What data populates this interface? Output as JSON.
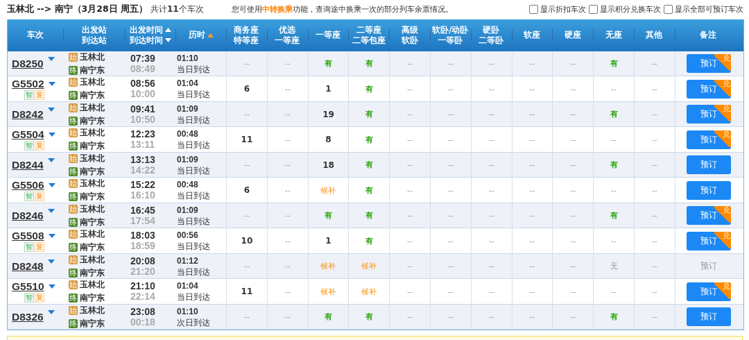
{
  "route": {
    "title": "玉林北 --> 南宁（3月28日  周五）",
    "count_prefix": "共计",
    "count": "11",
    "count_suffix": "个车次"
  },
  "notice": {
    "before": "您可使用",
    "link": "中转换乘",
    "after": "功能，查询途中换乘一次的部分列车余票情况。"
  },
  "filters": [
    {
      "label": "显示折扣车次",
      "checked": false
    },
    {
      "label": "显示积分兑换车次",
      "checked": false
    },
    {
      "label": "显示全部可预订车次",
      "checked": false
    }
  ],
  "columns": [
    {
      "lines": [
        {
          "text": "车次"
        }
      ]
    },
    {
      "lines": [
        {
          "text": "出发站"
        },
        {
          "text": "到达站"
        }
      ]
    },
    {
      "lines": [
        {
          "text": "出发时间",
          "ascending": true,
          "active": false
        },
        {
          "text": "到达时间",
          "ascending": false,
          "active": false
        }
      ]
    },
    {
      "lines": [
        {
          "text": "历时",
          "ascending": true,
          "active": true
        }
      ]
    },
    {
      "lines": [
        {
          "text": "商务座"
        },
        {
          "text": "特等座"
        }
      ]
    },
    {
      "lines": [
        {
          "text": "优选"
        },
        {
          "text": "一等座"
        }
      ]
    },
    {
      "lines": [
        {
          "text": "一等座"
        }
      ]
    },
    {
      "lines": [
        {
          "text": "二等座"
        },
        {
          "text": "二等包座"
        }
      ]
    },
    {
      "lines": [
        {
          "text": "高级"
        },
        {
          "text": "软卧"
        }
      ]
    },
    {
      "lines": [
        {
          "text": "软卧/动卧"
        },
        {
          "text": "一等卧"
        }
      ]
    },
    {
      "lines": [
        {
          "text": "硬卧"
        },
        {
          "text": "二等卧"
        }
      ]
    },
    {
      "lines": [
        {
          "text": "软座"
        }
      ]
    },
    {
      "lines": [
        {
          "text": "硬座"
        }
      ]
    },
    {
      "lines": [
        {
          "text": "无座"
        }
      ]
    },
    {
      "lines": [
        {
          "text": "其他"
        }
      ]
    },
    {
      "lines": [
        {
          "text": "备注"
        }
      ]
    }
  ],
  "trains": [
    {
      "number": "D8250",
      "from_tag": "始",
      "from": "玉林北",
      "to_tag": "终",
      "to": "南宁东",
      "depart": "07:39",
      "arrive": "08:49",
      "duration": "01:10",
      "arrival_day": "当日到达",
      "seats": [
        {
          "t": "--",
          "kind": "none"
        },
        {
          "t": "--",
          "kind": "none"
        },
        {
          "t": "有",
          "kind": "have"
        },
        {
          "t": "有",
          "kind": "have"
        },
        {
          "t": "--",
          "kind": "none"
        },
        {
          "t": "--",
          "kind": "none"
        },
        {
          "t": "--",
          "kind": "none"
        },
        {
          "t": "--",
          "kind": "none"
        },
        {
          "t": "--",
          "kind": "none"
        },
        {
          "t": "有",
          "kind": "have"
        },
        {
          "t": "--",
          "kind": "none"
        }
      ],
      "book": {
        "label": "预订",
        "enabled": true,
        "badge": "兑"
      }
    },
    {
      "number": "G5502",
      "tags": [
        {
          "text": "智",
          "kind": "smart"
        },
        {
          "text": "复",
          "kind": "return"
        }
      ],
      "from_tag": "始",
      "from": "玉林北",
      "to_tag": "终",
      "to": "南宁东",
      "depart": "08:56",
      "arrive": "10:00",
      "duration": "01:04",
      "arrival_day": "当日到达",
      "seats": [
        {
          "t": "6",
          "kind": "count"
        },
        {
          "t": "--",
          "kind": "none"
        },
        {
          "t": "1",
          "kind": "count"
        },
        {
          "t": "有",
          "kind": "have"
        },
        {
          "t": "--",
          "kind": "none"
        },
        {
          "t": "--",
          "kind": "none"
        },
        {
          "t": "--",
          "kind": "none"
        },
        {
          "t": "--",
          "kind": "none"
        },
        {
          "t": "--",
          "kind": "none"
        },
        {
          "t": "--",
          "kind": "none"
        },
        {
          "t": "--",
          "kind": "none"
        }
      ],
      "book": {
        "label": "预订",
        "enabled": true,
        "badge": "兑"
      }
    },
    {
      "number": "D8242",
      "from_tag": "始",
      "from": "玉林北",
      "to_tag": "终",
      "to": "南宁东",
      "depart": "09:41",
      "arrive": "10:50",
      "duration": "01:09",
      "arrival_day": "当日到达",
      "seats": [
        {
          "t": "--",
          "kind": "none"
        },
        {
          "t": "--",
          "kind": "none"
        },
        {
          "t": "19",
          "kind": "count"
        },
        {
          "t": "有",
          "kind": "have"
        },
        {
          "t": "--",
          "kind": "none"
        },
        {
          "t": "--",
          "kind": "none"
        },
        {
          "t": "--",
          "kind": "none"
        },
        {
          "t": "--",
          "kind": "none"
        },
        {
          "t": "--",
          "kind": "none"
        },
        {
          "t": "有",
          "kind": "have"
        },
        {
          "t": "--",
          "kind": "none"
        }
      ],
      "book": {
        "label": "预订",
        "enabled": true,
        "badge": "兑"
      }
    },
    {
      "number": "G5504",
      "tags": [
        {
          "text": "智",
          "kind": "smart"
        },
        {
          "text": "复",
          "kind": "return"
        }
      ],
      "from_tag": "始",
      "from": "玉林北",
      "to_tag": "终",
      "to": "南宁东",
      "depart": "12:23",
      "arrive": "13:11",
      "duration": "00:48",
      "arrival_day": "当日到达",
      "seats": [
        {
          "t": "11",
          "kind": "count"
        },
        {
          "t": "--",
          "kind": "none"
        },
        {
          "t": "8",
          "kind": "count"
        },
        {
          "t": "有",
          "kind": "have"
        },
        {
          "t": "--",
          "kind": "none"
        },
        {
          "t": "--",
          "kind": "none"
        },
        {
          "t": "--",
          "kind": "none"
        },
        {
          "t": "--",
          "kind": "none"
        },
        {
          "t": "--",
          "kind": "none"
        },
        {
          "t": "--",
          "kind": "none"
        },
        {
          "t": "--",
          "kind": "none"
        }
      ],
      "book": {
        "label": "预订",
        "enabled": true,
        "badge": "兑"
      }
    },
    {
      "number": "D8244",
      "from_tag": "始",
      "from": "玉林北",
      "to_tag": "终",
      "to": "南宁东",
      "depart": "13:13",
      "arrive": "14:22",
      "duration": "01:09",
      "arrival_day": "当日到达",
      "seats": [
        {
          "t": "--",
          "kind": "none"
        },
        {
          "t": "--",
          "kind": "none"
        },
        {
          "t": "18",
          "kind": "count"
        },
        {
          "t": "有",
          "kind": "have"
        },
        {
          "t": "--",
          "kind": "none"
        },
        {
          "t": "--",
          "kind": "none"
        },
        {
          "t": "--",
          "kind": "none"
        },
        {
          "t": "--",
          "kind": "none"
        },
        {
          "t": "--",
          "kind": "none"
        },
        {
          "t": "有",
          "kind": "have"
        },
        {
          "t": "--",
          "kind": "none"
        }
      ],
      "book": {
        "label": "预订",
        "enabled": true
      }
    },
    {
      "number": "G5506",
      "tags": [
        {
          "text": "智",
          "kind": "smart"
        },
        {
          "text": "复",
          "kind": "return"
        }
      ],
      "from_tag": "始",
      "from": "玉林北",
      "to_tag": "终",
      "to": "南宁东",
      "depart": "15:22",
      "arrive": "16:10",
      "duration": "00:48",
      "arrival_day": "当日到达",
      "seats": [
        {
          "t": "6",
          "kind": "count"
        },
        {
          "t": "--",
          "kind": "none"
        },
        {
          "t": "候补",
          "kind": "wait"
        },
        {
          "t": "有",
          "kind": "have"
        },
        {
          "t": "--",
          "kind": "none"
        },
        {
          "t": "--",
          "kind": "none"
        },
        {
          "t": "--",
          "kind": "none"
        },
        {
          "t": "--",
          "kind": "none"
        },
        {
          "t": "--",
          "kind": "none"
        },
        {
          "t": "--",
          "kind": "none"
        },
        {
          "t": "--",
          "kind": "none"
        }
      ],
      "book": {
        "label": "预订",
        "enabled": true
      }
    },
    {
      "number": "D8246",
      "from_tag": "始",
      "from": "玉林北",
      "to_tag": "终",
      "to": "南宁东",
      "depart": "16:45",
      "arrive": "17:54",
      "duration": "01:09",
      "arrival_day": "当日到达",
      "seats": [
        {
          "t": "--",
          "kind": "none"
        },
        {
          "t": "--",
          "kind": "none"
        },
        {
          "t": "有",
          "kind": "have"
        },
        {
          "t": "有",
          "kind": "have"
        },
        {
          "t": "--",
          "kind": "none"
        },
        {
          "t": "--",
          "kind": "none"
        },
        {
          "t": "--",
          "kind": "none"
        },
        {
          "t": "--",
          "kind": "none"
        },
        {
          "t": "--",
          "kind": "none"
        },
        {
          "t": "有",
          "kind": "have"
        },
        {
          "t": "--",
          "kind": "none"
        }
      ],
      "book": {
        "label": "预订",
        "enabled": true,
        "badge": "兑"
      }
    },
    {
      "number": "G5508",
      "tags": [
        {
          "text": "智",
          "kind": "smart"
        },
        {
          "text": "复",
          "kind": "return"
        }
      ],
      "from_tag": "始",
      "from": "玉林北",
      "to_tag": "终",
      "to": "南宁东",
      "depart": "18:03",
      "arrive": "18:59",
      "duration": "00:56",
      "arrival_day": "当日到达",
      "seats": [
        {
          "t": "10",
          "kind": "count"
        },
        {
          "t": "--",
          "kind": "none"
        },
        {
          "t": "1",
          "kind": "count"
        },
        {
          "t": "有",
          "kind": "have"
        },
        {
          "t": "--",
          "kind": "none"
        },
        {
          "t": "--",
          "kind": "none"
        },
        {
          "t": "--",
          "kind": "none"
        },
        {
          "t": "--",
          "kind": "none"
        },
        {
          "t": "--",
          "kind": "none"
        },
        {
          "t": "--",
          "kind": "none"
        },
        {
          "t": "--",
          "kind": "none"
        }
      ],
      "book": {
        "label": "预订",
        "enabled": true,
        "badge": "兑"
      }
    },
    {
      "number": "D8248",
      "from_tag": "始",
      "from": "玉林北",
      "to_tag": "终",
      "to": "南宁东",
      "depart": "20:08",
      "arrive": "21:20",
      "duration": "01:12",
      "arrival_day": "当日到达",
      "seats": [
        {
          "t": "--",
          "kind": "none"
        },
        {
          "t": "--",
          "kind": "none"
        },
        {
          "t": "候补",
          "kind": "wait"
        },
        {
          "t": "候补",
          "kind": "wait"
        },
        {
          "t": "--",
          "kind": "none"
        },
        {
          "t": "--",
          "kind": "none"
        },
        {
          "t": "--",
          "kind": "none"
        },
        {
          "t": "--",
          "kind": "none"
        },
        {
          "t": "--",
          "kind": "none"
        },
        {
          "t": "无",
          "kind": "soldout"
        },
        {
          "t": "--",
          "kind": "none"
        }
      ],
      "book": {
        "label": "预订",
        "enabled": false
      }
    },
    {
      "number": "G5510",
      "tags": [
        {
          "text": "智",
          "kind": "smart"
        },
        {
          "text": "复",
          "kind": "return"
        }
      ],
      "from_tag": "始",
      "from": "玉林北",
      "to_tag": "终",
      "to": "南宁东",
      "depart": "21:10",
      "arrive": "22:14",
      "duration": "01:04",
      "arrival_day": "当日到达",
      "seats": [
        {
          "t": "11",
          "kind": "count"
        },
        {
          "t": "--",
          "kind": "none"
        },
        {
          "t": "候补",
          "kind": "wait"
        },
        {
          "t": "候补",
          "kind": "wait"
        },
        {
          "t": "--",
          "kind": "none"
        },
        {
          "t": "--",
          "kind": "none"
        },
        {
          "t": "--",
          "kind": "none"
        },
        {
          "t": "--",
          "kind": "none"
        },
        {
          "t": "--",
          "kind": "none"
        },
        {
          "t": "--",
          "kind": "none"
        },
        {
          "t": "--",
          "kind": "none"
        }
      ],
      "book": {
        "label": "预订",
        "enabled": true,
        "badge": "兑"
      }
    },
    {
      "number": "D8326",
      "from_tag": "始",
      "from": "玉林北",
      "to_tag": "终",
      "to": "南宁东",
      "depart": "23:08",
      "arrive": "00:18",
      "duration": "01:10",
      "arrival_day": "次日到达",
      "seats": [
        {
          "t": "--",
          "kind": "none"
        },
        {
          "t": "--",
          "kind": "none"
        },
        {
          "t": "有",
          "kind": "have"
        },
        {
          "t": "有",
          "kind": "have"
        },
        {
          "t": "--",
          "kind": "none"
        },
        {
          "t": "--",
          "kind": "none"
        },
        {
          "t": "--",
          "kind": "none"
        },
        {
          "t": "--",
          "kind": "none"
        },
        {
          "t": "--",
          "kind": "none"
        },
        {
          "t": "有",
          "kind": "have"
        },
        {
          "t": "--",
          "kind": "none"
        }
      ],
      "book": {
        "label": "预订",
        "enabled": true
      }
    }
  ]
}
